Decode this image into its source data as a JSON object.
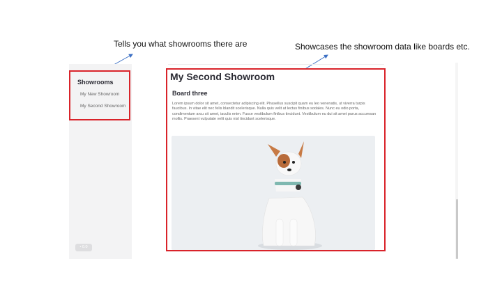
{
  "annotations": {
    "left": "Tells you what showrooms there are",
    "right": "Showcases the showroom data like boards etc."
  },
  "sidebar": {
    "title": "Showrooms",
    "items": [
      {
        "label": "My New Showroom"
      },
      {
        "label": "My Second Showroom"
      }
    ],
    "toggle_label": "• 0.0"
  },
  "main": {
    "title": "My Second Showroom",
    "board_title": "Board three",
    "board_text": "Lorem ipsum dolor sit amet, consectetur adipiscing elit. Phasellus suscipit quam eu leo venenatis, ut viverra turpis faucibus. In vitae elit nec felis blandit scelerisque. Nulla quis velit at lectus finibus sodales. Nunc eu odio porta, condimentum arcu sit amet, iaculis enim. Fusce vestibulum finibus tincidunt. Vestibulum eu dui sit amet purus accumsan mollis. Praesent vulputate velit quis nisl tincidunt scelerisque.",
    "image_alt": "dog photo"
  },
  "colors": {
    "highlight": "#d9232a",
    "arrow": "#3b6fc4"
  }
}
